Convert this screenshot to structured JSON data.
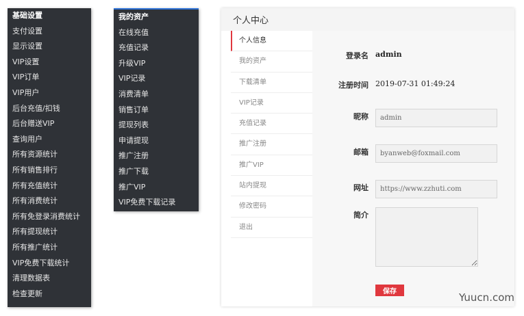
{
  "admin_menu": {
    "items": [
      "基础设置",
      "支付设置",
      "显示设置",
      "VIP设置",
      "VIP订单",
      "VIP用户",
      "后台充值/扣钱",
      "后台赠送VIP",
      "查询用户",
      "所有资源统计",
      "所有销售排行",
      "所有充值统计",
      "所有消费统计",
      "所有免登录消费统计",
      "所有提现统计",
      "所有推广统计",
      "VIP免费下载统计",
      "清理数据表",
      "检查更新"
    ]
  },
  "user_menu": {
    "items": [
      "我的资产",
      "在线充值",
      "充值记录",
      "升级VIP",
      "VIP记录",
      "消费清单",
      "销售订单",
      "提现列表",
      "申请提现",
      "推广注册",
      "推广下载",
      "推广VIP",
      "VIP免费下载记录"
    ]
  },
  "profile": {
    "title": "个人中心",
    "tabs": [
      "个人信息",
      "我的资产",
      "下载清单",
      "VIP记录",
      "充值记录",
      "推广注册",
      "推广VIP",
      "站内提现",
      "修改密码",
      "退出"
    ],
    "login_label": "登录名",
    "login_value": "admin",
    "reg_label": "注册时间",
    "reg_value": "2019-07-31 01:49:24",
    "nickname_label": "昵称",
    "nickname_value": "admin",
    "email_label": "邮箱",
    "email_value": "byanweb@foxmail.com",
    "url_label": "网址",
    "url_value": "https://www.zzhuti.com",
    "bio_label": "简介",
    "bio_value": "",
    "save_label": "保存"
  },
  "watermark": "Yuucn.com",
  "colors": {
    "sidebar_bg": "#2f3237",
    "accent": "#e0383e",
    "highlight_line": "#2a6fd6"
  }
}
